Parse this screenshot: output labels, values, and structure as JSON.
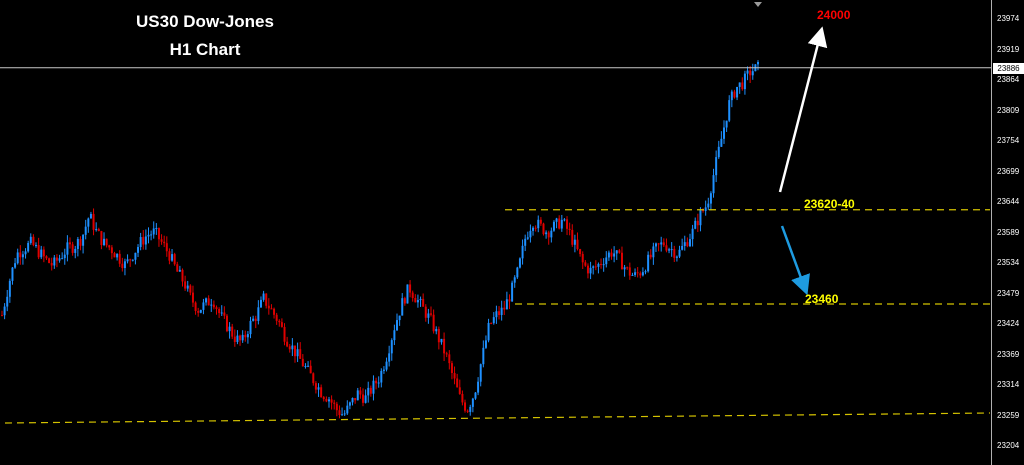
{
  "chart_data": {
    "type": "candlestick",
    "title_lines": [
      "US30 Dow-Jones",
      "H1 Chart"
    ],
    "price_axis": {
      "ticks": [
        "23974",
        "23919",
        "23864",
        "23809",
        "23754",
        "23699",
        "23644",
        "23589",
        "23534",
        "23479",
        "23424",
        "23369",
        "23314",
        "23259",
        "23204"
      ],
      "current_price": "23886"
    },
    "levels": [
      {
        "label": "23620-40",
        "value": 23630
      },
      {
        "label": "23460",
        "value": 23460
      },
      {
        "label": "",
        "value": 23260
      }
    ],
    "targets": [
      {
        "label": "24000",
        "direction": "up"
      },
      {
        "label": "",
        "direction": "down"
      }
    ],
    "price_path": [
      23440,
      23500,
      23550,
      23560,
      23570,
      23555,
      23540,
      23530,
      23545,
      23560,
      23565,
      23580,
      23620,
      23590,
      23570,
      23560,
      23545,
      23530,
      23550,
      23570,
      23585,
      23590,
      23570,
      23550,
      23520,
      23500,
      23470,
      23450,
      23460,
      23470,
      23440,
      23420,
      23400,
      23390,
      23420,
      23440,
      23470,
      23450,
      23430,
      23400,
      23380,
      23360,
      23340,
      23320,
      23300,
      23290,
      23270,
      23260,
      23280,
      23300,
      23290,
      23310,
      23330,
      23370,
      23420,
      23460,
      23490,
      23470,
      23450,
      23430,
      23400,
      23370,
      23330,
      23290,
      23270,
      23300,
      23360,
      23420,
      23440,
      23450,
      23480,
      23520,
      23580,
      23610,
      23600,
      23590,
      23600,
      23610,
      23590,
      23560,
      23530,
      23520,
      23530,
      23545,
      23555,
      23540,
      23520,
      23510,
      23520,
      23540,
      23560,
      23570,
      23560,
      23550,
      23570,
      23590,
      23620,
      23640,
      23700,
      23760,
      23820,
      23850,
      23860,
      23880,
      23886
    ],
    "colors": {
      "bull": "#1e90ff",
      "bear": "#e00000",
      "level_line": "#d4c200",
      "level_text": "#ffff00",
      "target_up_text": "#ff0000",
      "arrow_up": "#ffffff",
      "arrow_down": "#1e9be0",
      "current_line": "#c8c8c8"
    }
  }
}
